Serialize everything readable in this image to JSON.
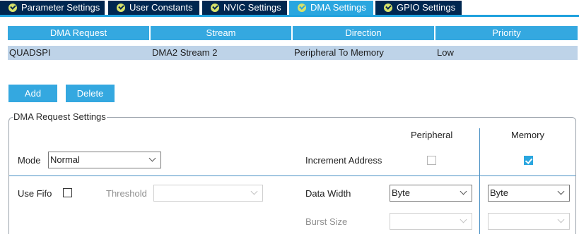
{
  "tabs": [
    {
      "label": "Parameter Settings",
      "active": false
    },
    {
      "label": "User Constants",
      "active": false
    },
    {
      "label": "NVIC Settings",
      "active": false
    },
    {
      "label": "DMA Settings",
      "active": true
    },
    {
      "label": "GPIO Settings",
      "active": false
    }
  ],
  "table": {
    "headers": [
      "DMA Request",
      "Stream",
      "Direction",
      "Priority"
    ],
    "rows": [
      [
        "QUADSPI",
        "DMA2 Stream 2",
        "Peripheral To Memory",
        "Low"
      ]
    ]
  },
  "buttons": {
    "add": "Add",
    "delete": "Delete"
  },
  "settings": {
    "title": "DMA Request Settings",
    "peripheral_header": "Peripheral",
    "memory_header": "Memory",
    "mode_label": "Mode",
    "mode_value": "Normal",
    "increment_label": "Increment Address",
    "increment_peripheral_checked": false,
    "increment_memory_checked": true,
    "use_fifo_label": "Use Fifo",
    "use_fifo_checked": false,
    "threshold_label": "Threshold",
    "threshold_value": "",
    "data_width_label": "Data Width",
    "data_width_peripheral": "Byte",
    "data_width_memory": "Byte",
    "burst_size_label": "Burst Size",
    "burst_size_peripheral": "",
    "burst_size_memory": ""
  },
  "colors": {
    "tab_bg": "#002750",
    "tab_active_bg": "#2aa6df",
    "header_bg": "#34a8e0",
    "row_selected_bg": "#bed3e8"
  },
  "icons": {
    "tab_status": "check-circle-icon",
    "dropdown": "chevron-down-icon"
  }
}
